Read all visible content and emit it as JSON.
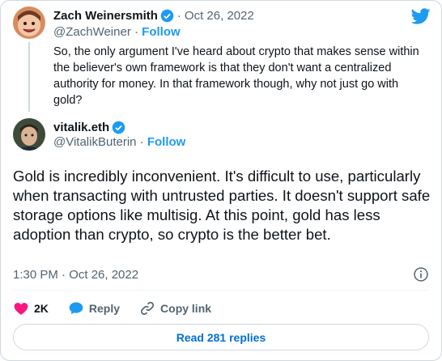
{
  "colors": {
    "accent": "#1d9bf0",
    "text_primary": "#0f1419",
    "text_secondary": "#536471",
    "like": "#f91880",
    "border": "#cfd9de"
  },
  "quoted_tweet": {
    "name": "Zach Weinersmith",
    "date": "Oct 26, 2022",
    "separator": "·",
    "handle": "@ZachWeiner",
    "follow_label": "Follow",
    "text": "So, the only argument I've heard about crypto that makes sense within the believer's own framework is that they don't want a centralized authority for money. In that framework though, why not just go with gold?",
    "icons": [
      "verified-badge-icon",
      "twitter-bird-icon"
    ]
  },
  "main_tweet": {
    "name": "vitalik.eth",
    "handle": "@VitalikButerin",
    "separator": "·",
    "follow_label": "Follow",
    "text": "Gold is incredibly inconvenient. It's difficult to use, particularly when transacting with untrusted parties. It doesn't support safe storage options like multisig. At this point, gold has less adoption than crypto, so crypto is the better bet.",
    "timestamp": "1:30 PM · Oct 26, 2022",
    "actions": {
      "like_count": "2K",
      "reply_label": "Reply",
      "copy_link_label": "Copy link"
    },
    "read_replies_label": "Read 281 replies",
    "icons": [
      "info-icon",
      "heart-icon",
      "reply-icon",
      "link-icon"
    ]
  }
}
